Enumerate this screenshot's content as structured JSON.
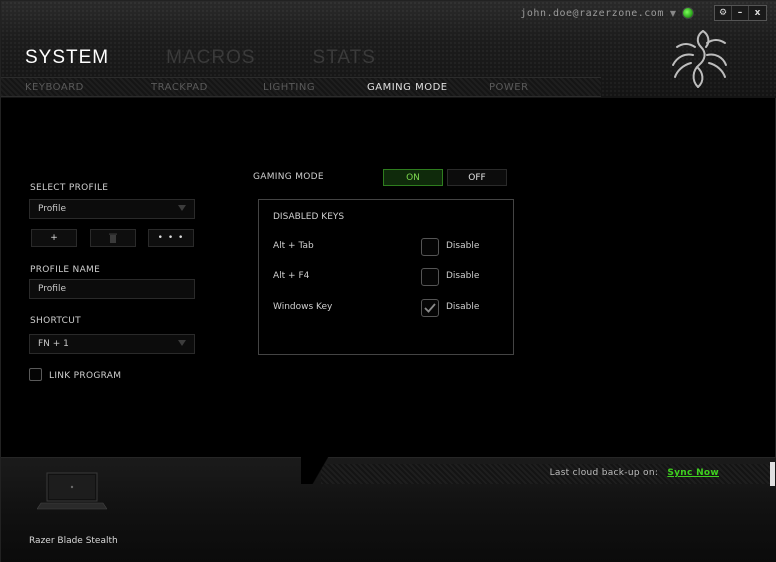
{
  "window": {
    "account_email": "john.doe@razerzone.com",
    "account_caret": "▼",
    "buttons": {
      "settings": "⚙",
      "minimize": "–",
      "close": "x"
    }
  },
  "main_tabs": [
    {
      "label": "SYSTEM",
      "active": true
    },
    {
      "label": "MACROS",
      "active": false
    },
    {
      "label": "STATS",
      "active": false
    }
  ],
  "sub_tabs": [
    {
      "label": "KEYBOARD",
      "active": false
    },
    {
      "label": "TRACKPAD",
      "active": false
    },
    {
      "label": "LIGHTING",
      "active": false
    },
    {
      "label": "GAMING MODE",
      "active": true
    },
    {
      "label": "POWER",
      "active": false
    }
  ],
  "profile": {
    "select_label": "SELECT PROFILE",
    "selected": "Profile",
    "add_label": "+",
    "delete_label": "🗑",
    "more_label": "• • •",
    "name_label": "PROFILE NAME",
    "name_value": "Profile",
    "shortcut_label": "SHORTCUT",
    "shortcut_value": "FN + 1",
    "link_program_label": "LINK PROGRAM",
    "link_program_checked": false
  },
  "gaming_mode": {
    "label": "GAMING MODE",
    "on_label": "ON",
    "off_label": "OFF",
    "state": "ON",
    "disabled_keys_title": "DISABLED KEYS",
    "keys": [
      {
        "name": "Alt + Tab",
        "action": "Disable",
        "checked": false
      },
      {
        "name": "Alt + F4",
        "action": "Disable",
        "checked": false
      },
      {
        "name": "Windows Key",
        "action": "Disable",
        "checked": true
      }
    ]
  },
  "footer": {
    "cloud_text": "Last cloud back-up on:",
    "sync_label": "Sync Now",
    "device_name": "Razer Blade Stealth"
  },
  "colors": {
    "accent_green": "#3fd11f",
    "background": "#000000",
    "text": "#c8c8c8"
  }
}
